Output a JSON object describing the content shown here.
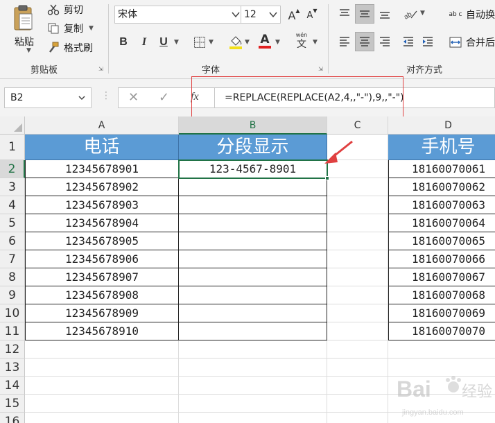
{
  "clipboard": {
    "paste_label": "粘贴",
    "cut_label": "剪切",
    "copy_label": "复制",
    "format_painter_label": "格式刷",
    "group_label": "剪贴板"
  },
  "font": {
    "font_name": "宋体",
    "font_size": "12",
    "bold": "B",
    "italic": "I",
    "underline": "U",
    "font_color_glyph": "A",
    "phonetic_glyph": "wén",
    "phonetic_char": "文",
    "grow_glyph": "A",
    "shrink_glyph": "A",
    "group_label": "字体"
  },
  "alignment": {
    "wrap_text_label": "自动换",
    "merge_label": "合并后",
    "wrap_icon_text": "ab c",
    "group_label": "对齐方式"
  },
  "formula_bar": {
    "name_box": "B2",
    "cancel_glyph": "✕",
    "enter_glyph": "✓",
    "fx_glyph": "fx",
    "formula": "=REPLACE(REPLACE(A2,4,,\"-\"),9,,\"-\")"
  },
  "columns": [
    "A",
    "B",
    "C",
    "D"
  ],
  "rows": [
    "1",
    "2",
    "3",
    "4",
    "5",
    "6",
    "7",
    "8",
    "9",
    "10",
    "11",
    "12",
    "13",
    "14",
    "15",
    "16"
  ],
  "cells": {
    "headers": {
      "A": "电话",
      "B": "分段显示",
      "D": "手机号"
    },
    "col_a": [
      "12345678901",
      "12345678902",
      "12345678903",
      "12345678904",
      "12345678905",
      "12345678906",
      "12345678907",
      "12345678908",
      "12345678909",
      "12345678910"
    ],
    "b2": "123-4567-8901",
    "col_d": [
      "18160070061",
      "18160070062",
      "18160070063",
      "18160070064",
      "18160070065",
      "18160070066",
      "18160070067",
      "18160070068",
      "18160070069",
      "18160070070"
    ]
  },
  "selection": {
    "active_cell": "B2"
  },
  "colors": {
    "header_fill": "#5b9bd5",
    "accent": "#217346",
    "annotation": "#e04040"
  },
  "watermark": {
    "brand": "Bai",
    "brand_cn": "经验",
    "url": "jingyan.baidu.com"
  }
}
